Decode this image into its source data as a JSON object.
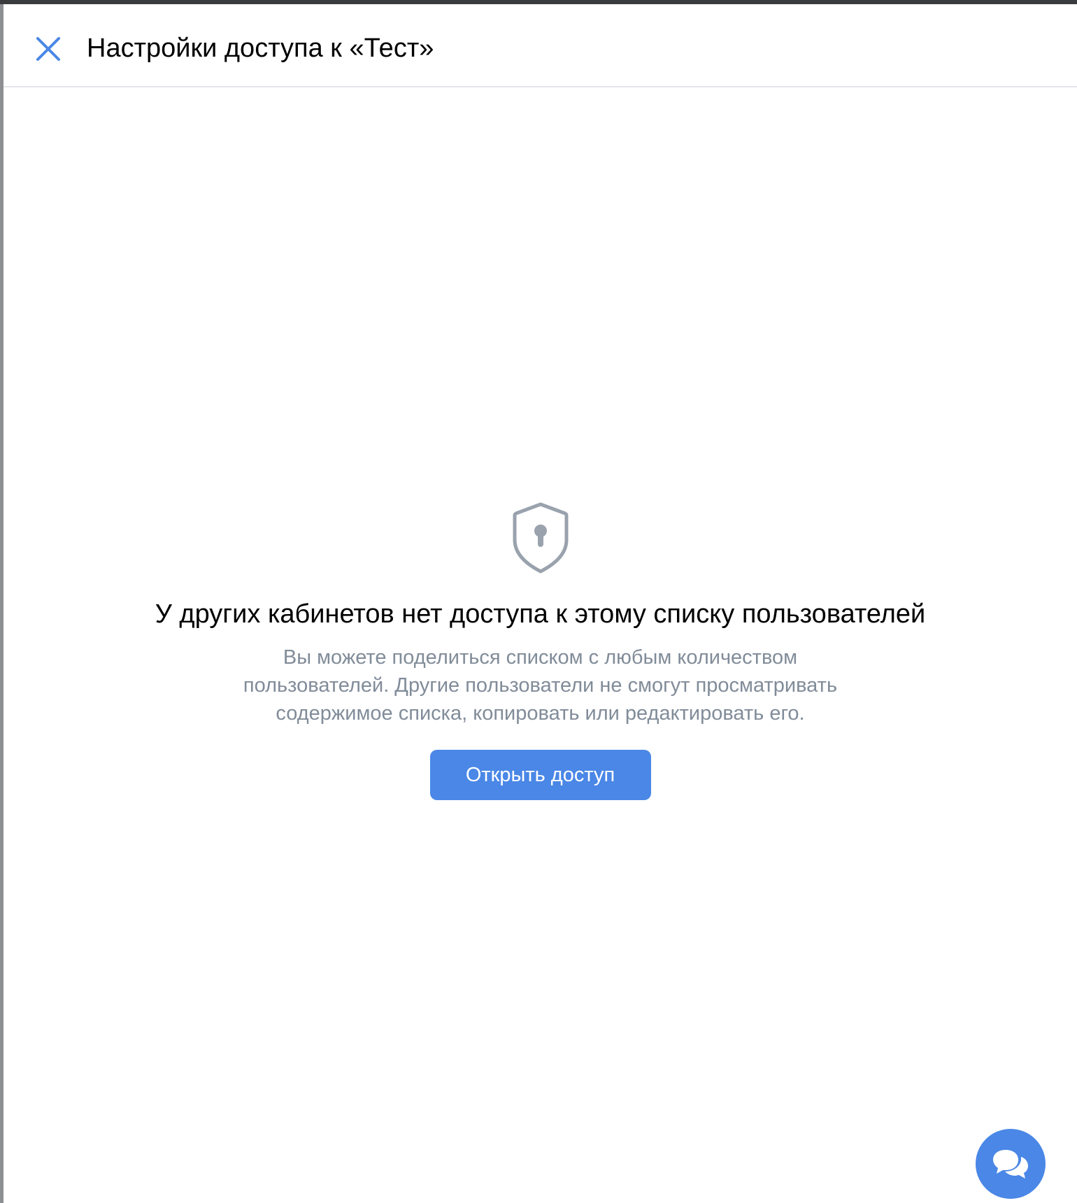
{
  "panel": {
    "title": "Настройки доступа к «Тест»",
    "close_icon": "close-icon"
  },
  "empty_state": {
    "icon": "shield-keyhole-icon",
    "title": "У других кабинетов нет доступа к этому списку пользователей",
    "description": "Вы можете поделиться списком с любым количеством пользователей. Другие пользователи не смогут просматривать содержимое списка, копировать или редактировать его.",
    "button_label": "Открыть доступ"
  },
  "chat_fab": {
    "icon": "chat-bubbles-icon"
  },
  "colors": {
    "accent": "#4a87e6",
    "secondary_text": "#818c99",
    "divider": "#e3e5e8",
    "icon_gray": "#99a2ad"
  }
}
